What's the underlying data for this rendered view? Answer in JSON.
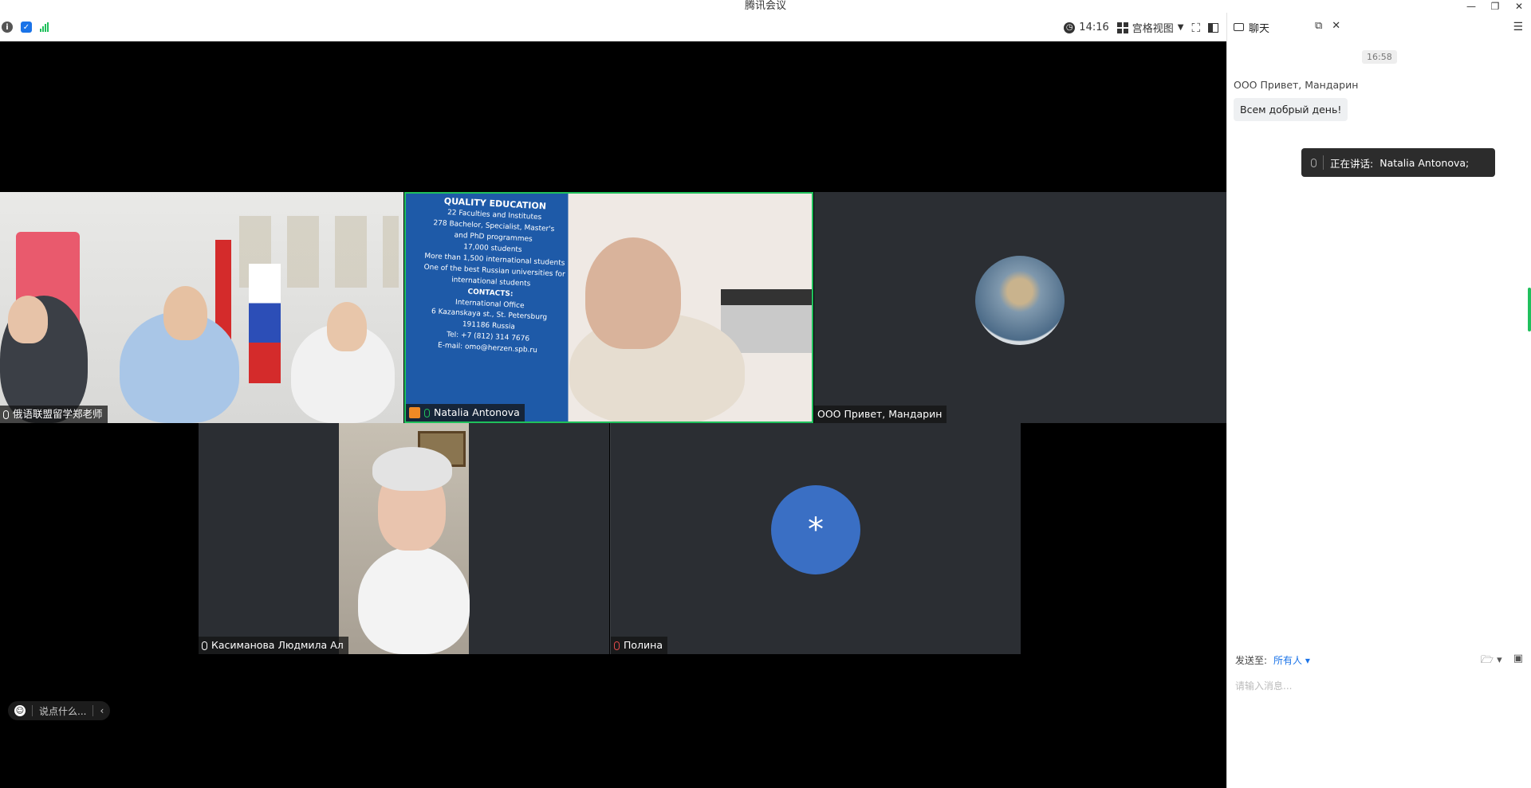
{
  "window": {
    "title": "腾讯会议"
  },
  "toolbar": {
    "time": "14:16",
    "view_label": "宫格视图"
  },
  "participants": [
    {
      "name": "俄语联盟留学郑老师"
    },
    {
      "name": "Natalia Antonova"
    },
    {
      "name": "ООО Привет, Мандарин"
    },
    {
      "name": "Касиманова Людмила Ал"
    },
    {
      "name": "Полина",
      "avatar_text": "*"
    }
  ],
  "slide_text": [
    "QUALITY EDUCATION",
    "22 Faculties and Institutes",
    "278 Bachelor, Specialist, Master's",
    "and PhD programmes",
    "17,000 students",
    "More than 1,500 international students",
    "One of the best Russian universities for",
    "international students",
    "CONTACTS:",
    "International Office",
    "6 Kazanskaya st., St. Petersburg",
    "191186 Russia",
    "Tel: +7 (812) 314 7676",
    "E-mail: omo@herzen.spb.ru"
  ],
  "emoji_bar": {
    "placeholder": "说点什么..."
  },
  "chat": {
    "title": "聊天",
    "timestamp": "16:58",
    "sender": "ООО Привет, Мандарин",
    "message": "Всем добрый день!",
    "speaking_label": "正在讲话:",
    "speaking_name": "Natalia Antonova;",
    "send_to_label": "发送至:",
    "send_to_value": "所有人",
    "input_placeholder": "请输入消息..."
  },
  "colors": {
    "accent": "#20c05c",
    "link": "#1a73e8",
    "avatar_blue": "#3a6fc4"
  }
}
